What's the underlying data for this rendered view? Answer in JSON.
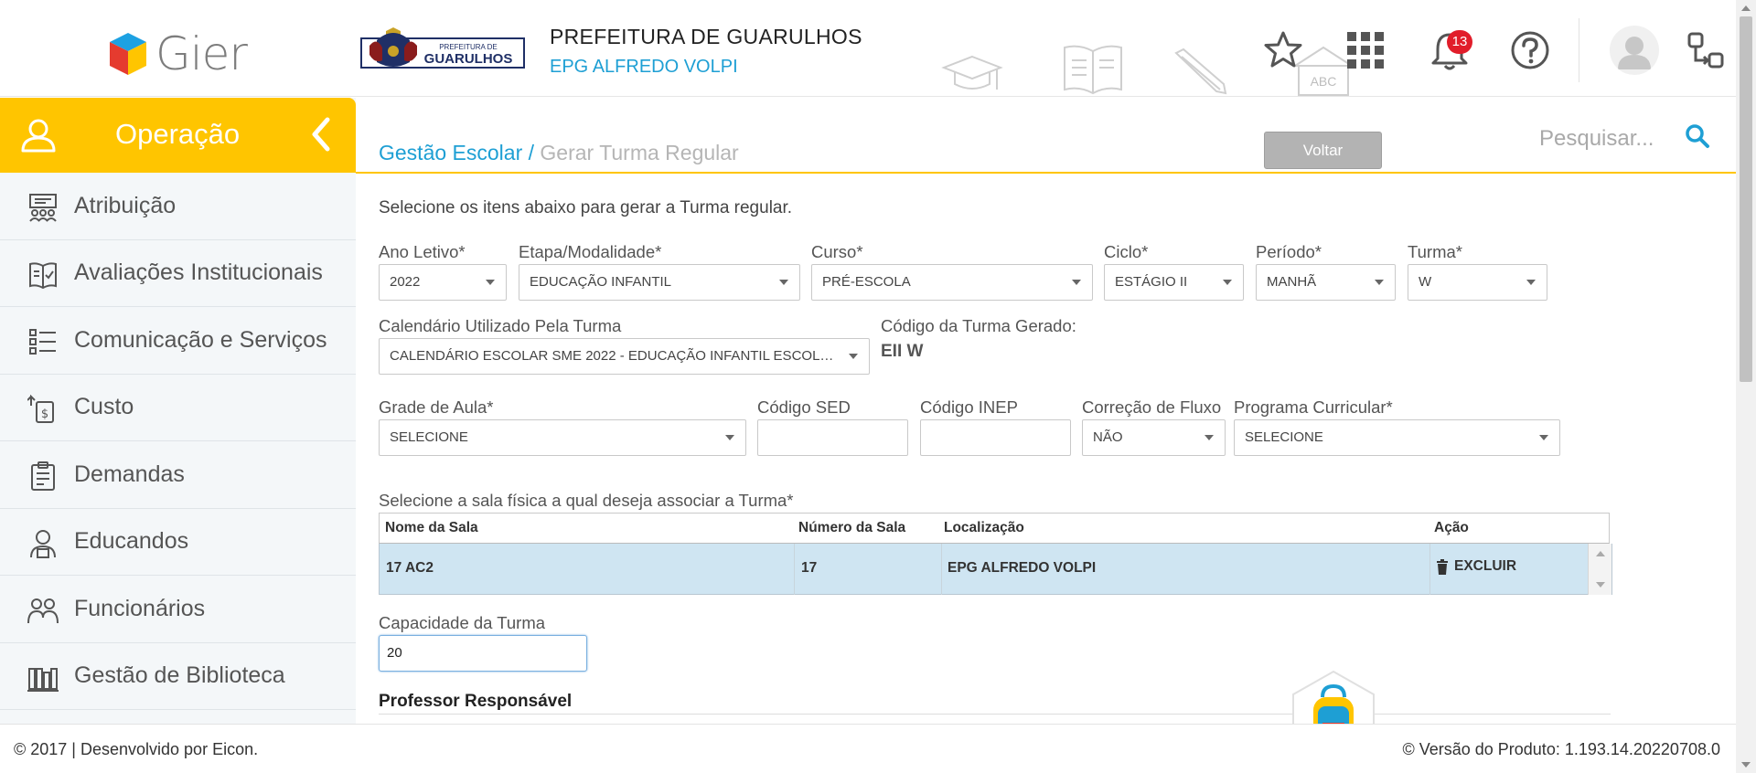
{
  "header": {
    "brand": "Gier",
    "crest_text_1": "PREFEITURA DE",
    "crest_text_2": "GUARULHOS",
    "title": "PREFEITURA DE GUARULHOS",
    "school": "EPG ALFREDO VOLPI",
    "deco_label": "ABC",
    "notifications_count": "13",
    "icons": [
      "star-icon",
      "apps-grid-icon",
      "bell-icon",
      "help-icon",
      "avatar",
      "switch-profile-icon"
    ]
  },
  "sidebar": {
    "title": "Operação",
    "items": [
      {
        "label": "Atribuição",
        "icon": "assignment-icon"
      },
      {
        "label": "Avaliações Institucionais",
        "icon": "book-check-icon"
      },
      {
        "label": "Comunicação e Serviços",
        "icon": "checklist-icon"
      },
      {
        "label": "Custo",
        "icon": "cost-icon"
      },
      {
        "label": "Demandas",
        "icon": "clipboard-icon"
      },
      {
        "label": "Educandos",
        "icon": "student-icon"
      },
      {
        "label": "Funcionários",
        "icon": "staff-icon"
      },
      {
        "label": "Gestão de Biblioteca",
        "icon": "library-icon"
      }
    ]
  },
  "breadcrumb": {
    "parent": "Gestão Escolar /",
    "current": "Gerar Turma Regular"
  },
  "toolbar": {
    "back_label": "Voltar",
    "search_placeholder": "Pesquisar..."
  },
  "form": {
    "hint": "Selecione os itens abaixo para gerar a Turma regular.",
    "ano_letivo": {
      "label": "Ano Letivo*",
      "value": "2022"
    },
    "etapa": {
      "label": "Etapa/Modalidade*",
      "value": "EDUCAÇÃO INFANTIL"
    },
    "curso": {
      "label": "Curso*",
      "value": "PRÉ-ESCOLA"
    },
    "ciclo": {
      "label": "Ciclo*",
      "value": "ESTÁGIO II"
    },
    "periodo": {
      "label": "Período*",
      "value": "MANHÃ"
    },
    "turma": {
      "label": "Turma*",
      "value": "W"
    },
    "calendario": {
      "label": "Calendário Utilizado Pela Turma",
      "value": "CALENDÁRIO ESCOLAR SME 2022 - EDUCAÇÃO INFANTIL ESCOLAS ..."
    },
    "codigo_gerado": {
      "label": "Código da Turma Gerado:",
      "value": "EII W"
    },
    "grade": {
      "label": "Grade de Aula*",
      "value": "SELECIONE"
    },
    "codigo_sed": {
      "label": "Código SED",
      "value": ""
    },
    "codigo_inep": {
      "label": "Código INEP",
      "value": ""
    },
    "correcao": {
      "label": "Correção de Fluxo",
      "value": "NÃO"
    },
    "programa": {
      "label": "Programa Curricular*",
      "value": "SELECIONE"
    },
    "sala_label": "Selecione a sala física a qual deseja associar a Turma*",
    "capacidade": {
      "label": "Capacidade da Turma",
      "value": "20"
    },
    "professor_label": "Professor Responsável"
  },
  "rooms_table": {
    "columns": [
      "Nome da Sala",
      "Número da Sala",
      "Localização",
      "Ação"
    ],
    "rows": [
      {
        "nome": "17 AC2",
        "numero": "17",
        "localizacao": "EPG ALFREDO VOLPI",
        "acao": "EXCLUIR"
      }
    ]
  },
  "footer": {
    "left": "© 2017 | Desenvolvido por Eicon.",
    "right": "© Versão do Produto: 1.193.14.20220708.0"
  },
  "colors": {
    "accent": "#ffc500",
    "link": "#1e9fd4",
    "selected_row": "#cfe5f2",
    "badge": "#e11d2a"
  }
}
